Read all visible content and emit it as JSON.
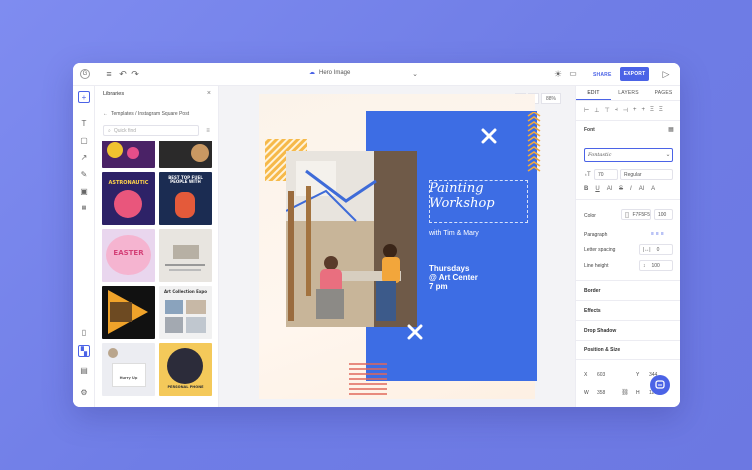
{
  "topbar": {
    "doc_title": "Hero Image",
    "share_label": "SHARE",
    "export_label": "EXPORT"
  },
  "library": {
    "title": "Libraries",
    "breadcrumb": "Templates / Instagram Square Post",
    "search_placeholder": "Quick find",
    "thumb_texts": [
      "ASTRONAUTIC",
      "BEST TOP FUEL\nPEOPLE WITH",
      "EASTER",
      "Art Collection Expo",
      "Hurry Up",
      "PERSONAL PHONE"
    ]
  },
  "canvas": {
    "zoom": "88%",
    "title_line1": "Painting",
    "title_line2": "Workshop",
    "subtitle": "with Tim & Mary",
    "date_line1": "Thursdays",
    "date_line2": "@ Art Center",
    "date_line3": "7 pm"
  },
  "panel": {
    "tabs": [
      "EDIT",
      "LAYERS",
      "PAGES"
    ],
    "font_label": "Font",
    "font_value": "Fontastic",
    "size_value": "70",
    "weight_value": "Regular",
    "color_label": "Color",
    "color_hex": "F7F5F5",
    "color_opacity": "100",
    "paragraph_label": "Paragraph",
    "letter_spacing_label": "Letter spacing",
    "letter_spacing_value": "0",
    "line_height_label": "Line height",
    "line_height_value": "100",
    "sections": [
      "Border",
      "Effects",
      "Drop Shadow",
      "Position & Size"
    ],
    "x_label": "X",
    "x_value": "603",
    "y_label": "Y",
    "y_value": "344",
    "w_label": "W",
    "w_value": "358",
    "h_label": "H",
    "h_value": "116"
  },
  "colors": {
    "accent": "#4b63e6",
    "poster_blue": "#3d6de4",
    "orange": "#f2a93b",
    "stripe_red": "#e0675a"
  }
}
